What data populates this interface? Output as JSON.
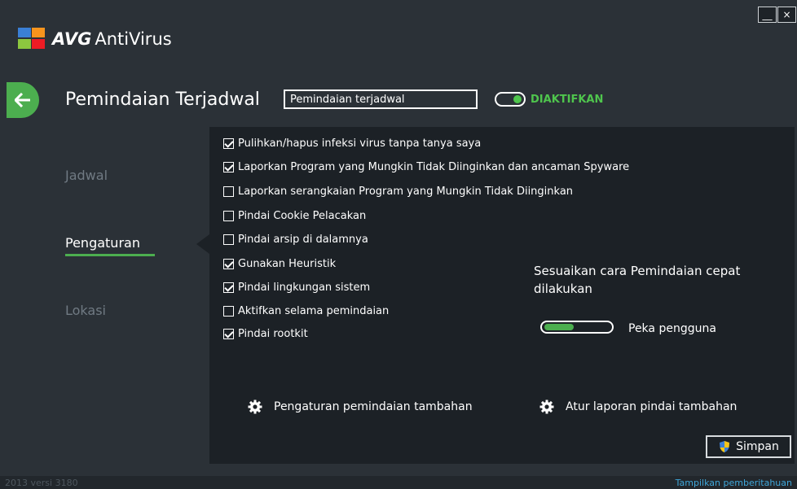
{
  "app": {
    "brand": "AVG",
    "product": "AntiVirus"
  },
  "window": {
    "minimize_label": "__",
    "close_label": "×"
  },
  "header": {
    "title": "Pemindaian Terjadwal",
    "name_value": "Pemindaian terjadwal",
    "status_label": "DIAKTIFKAN"
  },
  "nav": {
    "items": [
      "Jadwal",
      "Pengaturan",
      "Lokasi"
    ],
    "active": "Pengaturan"
  },
  "options": [
    {
      "label": "Pulihkan/hapus infeksi virus tanpa tanya saya",
      "checked": true
    },
    {
      "label": "Laporkan Program yang Mungkin Tidak Diinginkan dan ancaman Spyware",
      "checked": true
    },
    {
      "label": "Laporkan serangkaian Program yang Mungkin Tidak Diinginkan",
      "checked": false
    },
    {
      "label": "Pindai Cookie Pelacakan",
      "checked": false
    },
    {
      "label": "Pindai arsip di dalamnya",
      "checked": false
    },
    {
      "label": "Gunakan Heuristik",
      "checked": true
    },
    {
      "label": "Pindai lingkungan sistem",
      "checked": true
    },
    {
      "label": "Aktifkan selama pemindaian",
      "checked": false
    },
    {
      "label": "Pindai rootkit",
      "checked": true
    }
  ],
  "quick_scan": {
    "title": "Sesuaikan cara Pemindaian cepat dilakukan",
    "slider_label": "Peka pengguna",
    "slider_level": 0.45
  },
  "links": {
    "scan_settings": "Pengaturan pemindaian tambahan",
    "report_settings": "Atur laporan pindai tambahan"
  },
  "save_label": "Simpan",
  "footer": {
    "version": "2013  versi 3180",
    "notifications": "Tampilkan pemberitahuan"
  },
  "colors": {
    "accent": "#4cae4f",
    "status": "#4fc54d",
    "link": "#3fa6d9",
    "background": "#2b3137",
    "panel": "#1c2126"
  }
}
